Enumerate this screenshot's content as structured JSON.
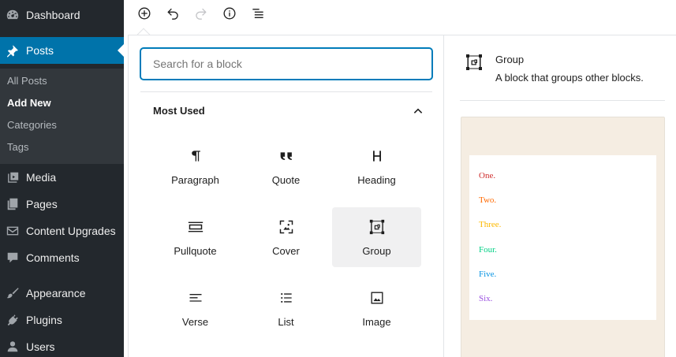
{
  "admin_menu": {
    "items": [
      {
        "label": "Dashboard",
        "icon": "dashboard-icon"
      },
      {
        "label": "Posts",
        "icon": "pin-icon"
      },
      {
        "label": "Media",
        "icon": "media-icon"
      },
      {
        "label": "Pages",
        "icon": "pages-icon"
      },
      {
        "label": "Content Upgrades",
        "icon": "envelope-icon"
      },
      {
        "label": "Comments",
        "icon": "comment-icon"
      },
      {
        "label": "Appearance",
        "icon": "brush-icon"
      },
      {
        "label": "Plugins",
        "icon": "plug-icon"
      },
      {
        "label": "Users",
        "icon": "user-icon"
      }
    ],
    "active": "Posts",
    "submenu": [
      "All Posts",
      "Add New",
      "Categories",
      "Tags"
    ],
    "submenu_current": "Add New"
  },
  "toolbar": {
    "buttons": [
      "add-block-icon",
      "undo-icon",
      "redo-icon",
      "info-icon",
      "outline-icon"
    ]
  },
  "inserter": {
    "search_placeholder": "Search for a block",
    "search_value": "",
    "panel_title": "Most Used",
    "blocks": [
      {
        "label": "Paragraph",
        "icon": "paragraph-icon"
      },
      {
        "label": "Quote",
        "icon": "quote-icon"
      },
      {
        "label": "Heading",
        "icon": "heading-icon"
      },
      {
        "label": "Pullquote",
        "icon": "pullquote-icon"
      },
      {
        "label": "Cover",
        "icon": "cover-icon"
      },
      {
        "label": "Group",
        "icon": "group-icon"
      },
      {
        "label": "Verse",
        "icon": "verse-icon"
      },
      {
        "label": "List",
        "icon": "list-icon"
      },
      {
        "label": "Image",
        "icon": "image-icon"
      }
    ],
    "selected_block": "Group"
  },
  "preview": {
    "title": "Group",
    "description": "A block that groups other blocks.",
    "lines": [
      {
        "text": "One.",
        "color": "#cf2e2e"
      },
      {
        "text": "Two.",
        "color": "#ff6900"
      },
      {
        "text": "Three.",
        "color": "#fcb900"
      },
      {
        "text": "Four.",
        "color": "#00d084"
      },
      {
        "text": "Five.",
        "color": "#0693e3"
      },
      {
        "text": "Six.",
        "color": "#9b51e0"
      }
    ],
    "background_color": "#f5ede2"
  },
  "colors": {
    "sidebar": "#23282d",
    "submenu": "#32373c",
    "accent": "#0073aa",
    "focus": "#007cba"
  }
}
